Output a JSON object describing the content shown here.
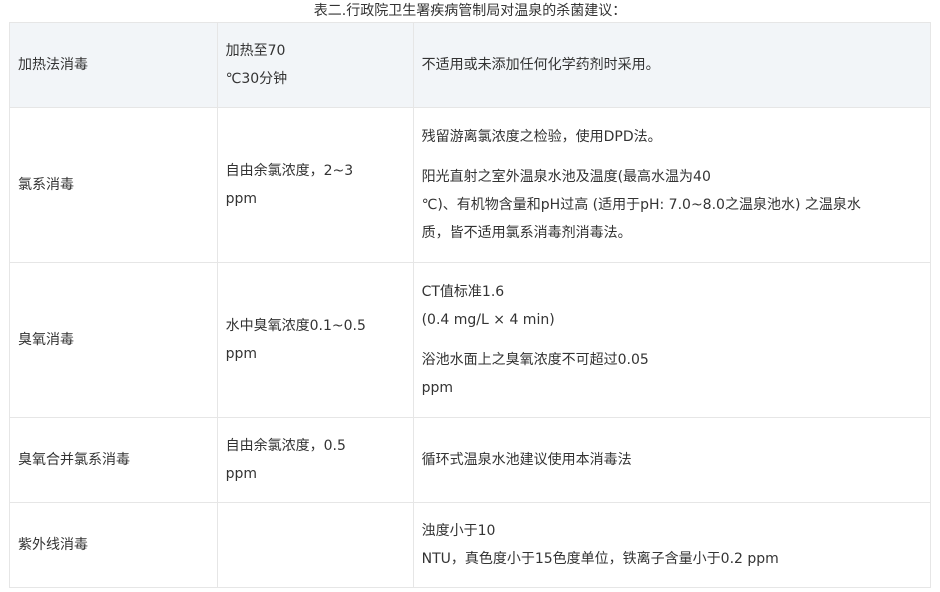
{
  "caption": "表二.行政院卫生署疾病管制局对温泉的杀菌建议：",
  "rows": [
    {
      "method": "加热法消毒",
      "condition": [
        "加热至70",
        "℃30分钟"
      ],
      "notes": [
        "不适用或未添加任何化学药剂时采用。"
      ]
    },
    {
      "method": "氯系消毒",
      "condition": [
        "自由余氯浓度，2~3",
        "ppm"
      ],
      "notes": [
        "残留游离氯浓度之检验，使用DPD法。",
        "阳光直射之室外温泉水池及温度(最高水温为40",
        "℃)、有机物含量和pH过高 (适用于pH: 7.0~8.0之温泉池水) 之温泉水",
        "质，皆不适用氯系消毒剂消毒法。"
      ]
    },
    {
      "method": "臭氧消毒",
      "condition": [
        "水中臭氧浓度0.1~0.5",
        "ppm"
      ],
      "notes": [
        "CT值标准1.6",
        "(0.4 mg/L × 4 min)",
        "浴池水面上之臭氧浓度不可超过0.05",
        "ppm"
      ]
    },
    {
      "method": "臭氧合并氯系消毒",
      "condition": [
        "自由余氯浓度，0.5",
        "ppm"
      ],
      "notes": [
        "循环式温泉水池建议使用本消毒法"
      ]
    },
    {
      "method": "紫外线消毒",
      "condition": [],
      "notes": [
        "浊度小于10",
        "NTU，真色度小于15色度单位，铁离子含量小于0.2 ppm"
      ]
    }
  ]
}
